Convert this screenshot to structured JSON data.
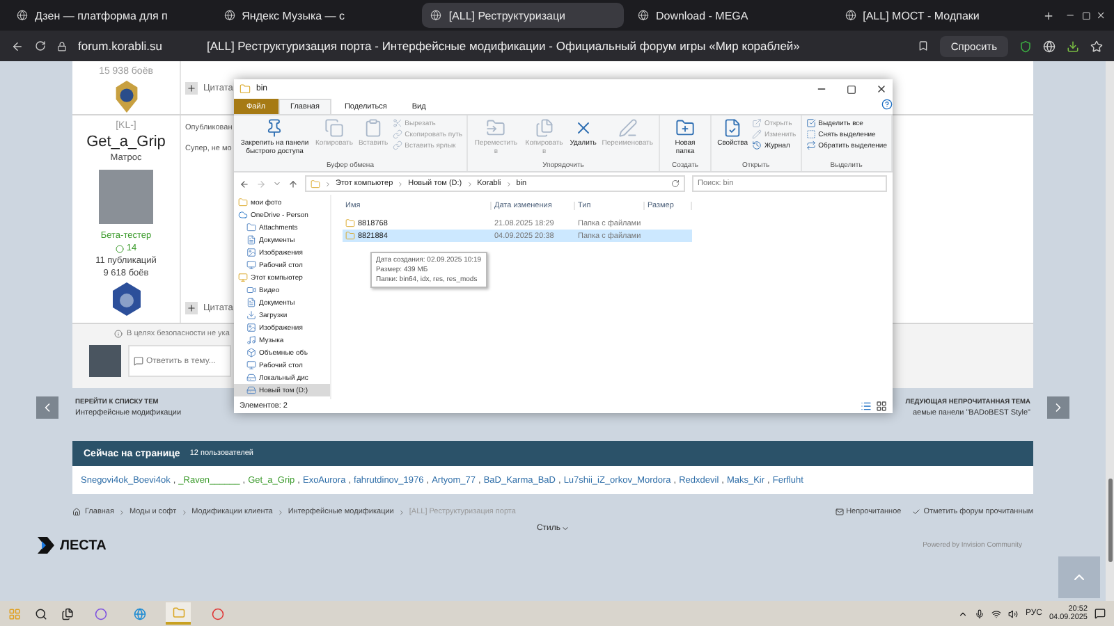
{
  "browser": {
    "tabs": [
      {
        "title": "Дзен — платформа для п",
        "selected": false
      },
      {
        "title": "Яндекс Музыка — с",
        "selected": false
      },
      {
        "title": "[ALL] Реструктуризаци",
        "selected": true
      },
      {
        "title": "Download - MEGA",
        "selected": false
      },
      {
        "title": "[ALL] МОСТ - Модпаки",
        "selected": false
      }
    ],
    "url": "forum.korabli.su",
    "page_title": "[ALL] Реструктуризация порта - Интерфейсные модификации - Официальный форум игры «Мир кораблей»",
    "ask_button": "Спросить"
  },
  "forum": {
    "prev_post": {
      "battles": "15 938 боёв",
      "quote": "Цитата"
    },
    "post": {
      "clan": "[KL-]",
      "author": "Get_a_Grip",
      "rank": "Матрос",
      "group": "Бета-тестер",
      "reputation": "14",
      "posts": "11 публикаций",
      "battles": "9 618 боёв",
      "published": "Опубликован",
      "text": "Супер, не мо",
      "quote": "Цитата"
    },
    "notice": "В целях безопасности не ука",
    "reply_placeholder": "Ответить в тему...",
    "prev_topic": {
      "caption": "ПЕРЕЙТИ К СПИСКУ ТЕМ",
      "title": "Интерфейсные модификации"
    },
    "next_topic": {
      "caption": "ЛЕДУЮЩАЯ НЕПРОЧИТАННАЯ ТЕМА",
      "title": "аемые панели \"BADoBEST Style\""
    },
    "online": {
      "title": "Сейчас на странице",
      "count": "12 пользователей",
      "separator": ",",
      "users": [
        {
          "name": "Snegovi4ok_Boevi4ok",
          "color": "#2f6ea8"
        },
        {
          "name": "_Raven______",
          "color": "#3a9a2a"
        },
        {
          "name": "Get_a_Grip",
          "color": "#3a9a2a"
        },
        {
          "name": "ExoAurora",
          "color": "#2f6ea8"
        },
        {
          "name": "fahrutdinov_1976",
          "color": "#2f6ea8"
        },
        {
          "name": "Artyom_77",
          "color": "#2f6ea8"
        },
        {
          "name": "BaD_Karma_BaD",
          "color": "#2f6ea8"
        },
        {
          "name": "Lu7shii_iZ_orkov_Mordora",
          "color": "#2f6ea8"
        },
        {
          "name": "Redxdevil",
          "color": "#2f6ea8"
        },
        {
          "name": "Maks_Kir",
          "color": "#2f6ea8"
        },
        {
          "name": "Ferfluht",
          "color": "#2f6ea8"
        }
      ]
    },
    "breadcrumbs": [
      "Главная",
      "Моды и софт",
      "Модификации клиента",
      "Интерфейсные модификации",
      "[ALL] Реструктуризация порта"
    ],
    "unread": "Непрочитанное",
    "mark_read": "Отметить форум прочитанным",
    "style": "Стиль",
    "logo": "ЛЕСТА",
    "powered": "Powered by Invision Community"
  },
  "explorer": {
    "title": "bin",
    "tabs": [
      {
        "label": "Файл",
        "kind": "menu",
        "selected": false
      },
      {
        "label": "Главная",
        "kind": "tab",
        "selected": true
      },
      {
        "label": "Поделиться",
        "kind": "tab",
        "selected": false
      },
      {
        "label": "Вид",
        "kind": "tab",
        "selected": false
      }
    ],
    "groups": [
      {
        "label": "Буфер обмена",
        "buttons": [
          {
            "label": "Закрепить на панели быстрого доступа",
            "kind": "large",
            "disabled": false
          },
          {
            "label": "Копировать",
            "kind": "large",
            "disabled": true
          },
          {
            "label": "Вставить",
            "kind": "large",
            "disabled": true
          },
          {
            "label": "Вырезать",
            "kind": "small",
            "disabled": true
          },
          {
            "label": "Скопировать путь",
            "kind": "small",
            "disabled": true
          },
          {
            "label": "Вставить ярлык",
            "kind": "small",
            "disabled": true
          }
        ]
      },
      {
        "label": "Упорядочить",
        "buttons": [
          {
            "label": "Переместить в",
            "kind": "large",
            "disabled": true
          },
          {
            "label": "Копировать в",
            "kind": "large",
            "disabled": true
          },
          {
            "label": "Удалить",
            "kind": "large",
            "disabled": false
          },
          {
            "label": "Переименовать",
            "kind": "large",
            "disabled": true
          }
        ]
      },
      {
        "label": "Создать",
        "buttons": [
          {
            "label": "Новая папка",
            "kind": "large",
            "disabled": false
          }
        ]
      },
      {
        "label": "Открыть",
        "buttons": [
          {
            "label": "Свойства",
            "kind": "large",
            "disabled": false
          },
          {
            "label": "Открыть",
            "kind": "small",
            "disabled": true
          },
          {
            "label": "Изменить",
            "kind": "small",
            "disabled": true
          },
          {
            "label": "Журнал",
            "kind": "small",
            "disabled": false
          }
        ]
      },
      {
        "label": "Выделить",
        "buttons": [
          {
            "label": "Выделить все",
            "kind": "small",
            "disabled": false
          },
          {
            "label": "Снять выделение",
            "kind": "small",
            "disabled": false
          },
          {
            "label": "Обратить выделение",
            "kind": "small",
            "disabled": false
          }
        ]
      }
    ],
    "path": [
      "Этот компьютер",
      "Новый том (D:)",
      "Korabli",
      "bin"
    ],
    "search_placeholder": "Поиск: bin",
    "nav": [
      {
        "label": "мои фото",
        "selected": false
      },
      {
        "label": "OneDrive - Person",
        "selected": false,
        "children": [
          {
            "label": "Attachments",
            "selected": false
          },
          {
            "label": "Документы",
            "selected": false
          },
          {
            "label": "Изображения",
            "selected": false
          },
          {
            "label": "Рабочий стол",
            "selected": false
          }
        ]
      },
      {
        "label": "Этот компьютер",
        "selected": false,
        "children": [
          {
            "label": "Видео",
            "selected": false
          },
          {
            "label": "Документы",
            "selected": false
          },
          {
            "label": "Загрузки",
            "selected": false
          },
          {
            "label": "Изображения",
            "selected": false
          },
          {
            "label": "Музыка",
            "selected": false
          },
          {
            "label": "Объемные объ",
            "selected": false
          },
          {
            "label": "Рабочий стол",
            "selected": false
          },
          {
            "label": "Локальный дис",
            "selected": false
          },
          {
            "label": "Новый том (D:)",
            "selected": true
          }
        ]
      }
    ],
    "columns": [
      "Имя",
      "Дата изменения",
      "Тип",
      "Размер"
    ],
    "rows": [
      {
        "name": "8818768",
        "date": "21.08.2025 18:29",
        "type": "Папка с файлами",
        "selected": false
      },
      {
        "name": "8821884",
        "date": "04.09.2025 20:38",
        "type": "Папка с файлами",
        "selected": true
      }
    ],
    "tooltip": [
      "Дата создания: 02.09.2025 10:19",
      "Размер: 439 МБ",
      "Папки: bin64, idx, res, res_mods"
    ],
    "status": "Элементов: 2"
  },
  "taskbar": {
    "language": "РУС",
    "time": "20:52",
    "date": "04.09.2025"
  }
}
